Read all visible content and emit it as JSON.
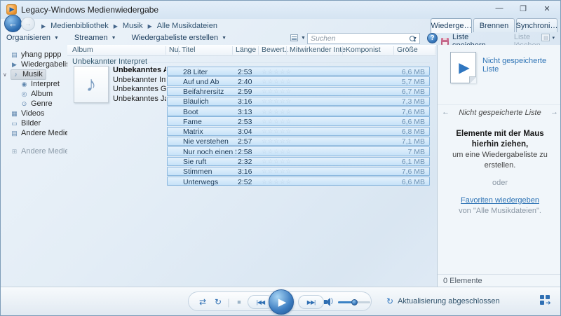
{
  "window": {
    "title": "Legacy-Windows Medienwiedergabe",
    "minimize": "—",
    "maximize": "❐",
    "close": "✕"
  },
  "nav": {
    "back": "←",
    "forward": "→",
    "crumb_sep": "▶",
    "breadcrumb": [
      "Medienbibliothek",
      "Musik",
      "Alle Musikdateien"
    ]
  },
  "tabs": {
    "play": "Wiederge…",
    "burn": "Brennen",
    "sync": "Synchroni…"
  },
  "toolbar": {
    "organize": "Organisieren",
    "stream": "Streamen",
    "create_playlist": "Wiedergabeliste erstellen",
    "caret": "▼",
    "search_placeholder": "Suchen",
    "help": "?",
    "save_list": "Liste speichern",
    "clear_list": "Liste löschen",
    "opts_caret": "▾"
  },
  "sidebar": {
    "chevron": "∨",
    "items": {
      "library": {
        "icon": "▤",
        "label": "yhang pppp"
      },
      "playlists": {
        "icon": "▶",
        "label": "Wiedergabelisten"
      },
      "music": {
        "icon": "♪",
        "label": "Musik"
      },
      "artist": {
        "icon": "◉",
        "label": "Interpret"
      },
      "album": {
        "icon": "◎",
        "label": "Album"
      },
      "genre": {
        "icon": "⊙",
        "label": "Genre"
      },
      "videos": {
        "icon": "▦",
        "label": "Videos"
      },
      "pictures": {
        "icon": "▭",
        "label": "Bilder"
      },
      "other_media": {
        "icon": "▤",
        "label": "Andere Medien"
      },
      "other_libraries": {
        "icon": "⊞",
        "label": "Andere Medienbibliotheken"
      }
    }
  },
  "library": {
    "columns": {
      "album": "Album",
      "number": "Nu…",
      "title": "Titel",
      "length": "Länge",
      "rating": "Bewert…",
      "contributing": "Mitwirkender Inter…",
      "composer": "Komponist",
      "size": "Größe"
    },
    "group": "Unbekannter Interpret",
    "album_note": "♪",
    "album_meta": [
      "Unbekanntes Alb…",
      "Unbekannter Inte…",
      "Unbekanntes Gen…",
      "Unbekanntes Jahr"
    ],
    "rating_glyphs": "☆☆☆☆☆",
    "tracks": [
      {
        "title": "28 Liter",
        "length": "2:53",
        "size": "6,6 MB"
      },
      {
        "title": "Auf und Ab",
        "length": "2:40",
        "size": "5,7 MB"
      },
      {
        "title": "Beifahrersitz",
        "length": "2:59",
        "size": "6,7 MB"
      },
      {
        "title": "Bläulich",
        "length": "3:16",
        "size": "7,3 MB"
      },
      {
        "title": "Boot",
        "length": "3:13",
        "size": "7,6 MB"
      },
      {
        "title": "Fame",
        "length": "2:53",
        "size": "6,6 MB"
      },
      {
        "title": "Matrix",
        "length": "3:04",
        "size": "6,8 MB"
      },
      {
        "title": "Nie verstehen",
        "length": "2:57",
        "size": "7,1 MB"
      },
      {
        "title": "Nur noch einen Sch…",
        "length": "2:58",
        "size": "7 MB"
      },
      {
        "title": "Sie ruft",
        "length": "2:32",
        "size": "6,1 MB"
      },
      {
        "title": "Stimmen",
        "length": "3:16",
        "size": "7,6 MB"
      },
      {
        "title": "Unterwegs",
        "length": "2:52",
        "size": "6,6 MB"
      }
    ]
  },
  "playlist_panel": {
    "doc_play": "▶",
    "unsaved_list_link": "Nicht gespeicherte Liste",
    "nav_left": "←",
    "nav_right": "→",
    "nav_label": "Nicht gespeicherte Liste",
    "drag_bold": "Elemente mit der Maus hierhin ziehen,",
    "drag_rest": "um eine Wiedergabeliste zu erstellen.",
    "or": "oder",
    "fav_link": "Favoriten wiedergeben",
    "fav_from": "von \"Alle Musikdateien\".",
    "item_count": "0 Elemente"
  },
  "playback": {
    "shuffle": "⇄",
    "repeat": "↻",
    "divider": "|",
    "stop": "■",
    "prev": "|◀◀",
    "play": "▶",
    "next": "▶▶|",
    "status": "Aktualisierung abgeschlossen",
    "status_icon": "↻",
    "np_arrow": "➜"
  },
  "colors": {
    "accent_blue": "#2f6fb3",
    "selection_fill": "#cde5f8",
    "selection_border": "#8cb8de",
    "link": "#2d73b5"
  }
}
